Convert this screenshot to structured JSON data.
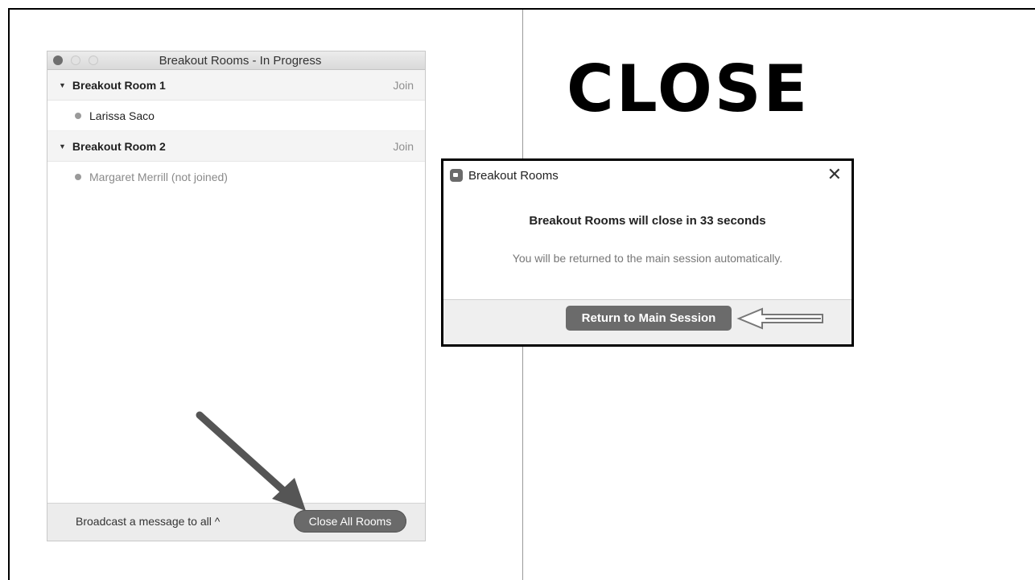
{
  "breakout_window": {
    "title": "Breakout Rooms - In Progress",
    "rooms": [
      {
        "name": "Breakout Room 1",
        "join_label": "Join",
        "participants": [
          {
            "name": "Larissa Saco"
          }
        ]
      },
      {
        "name": "Breakout Room 2",
        "join_label": "Join",
        "participants": [
          {
            "name": "Margaret Merrill (not joined)"
          }
        ]
      }
    ],
    "footer": {
      "broadcast_label": "Broadcast a message to all ^",
      "close_all_label": "Close All Rooms"
    }
  },
  "slide": {
    "heading": "CLOSE"
  },
  "dialog": {
    "title": "Breakout Rooms",
    "close_glyph": "✕",
    "message": "Breakout Rooms will close in 33 seconds",
    "submessage": "You will be returned to the main session automatically.",
    "return_label": "Return to Main Session"
  },
  "colors": {
    "button_gray": "#6b6b6b",
    "arrow_gray": "#666666"
  }
}
